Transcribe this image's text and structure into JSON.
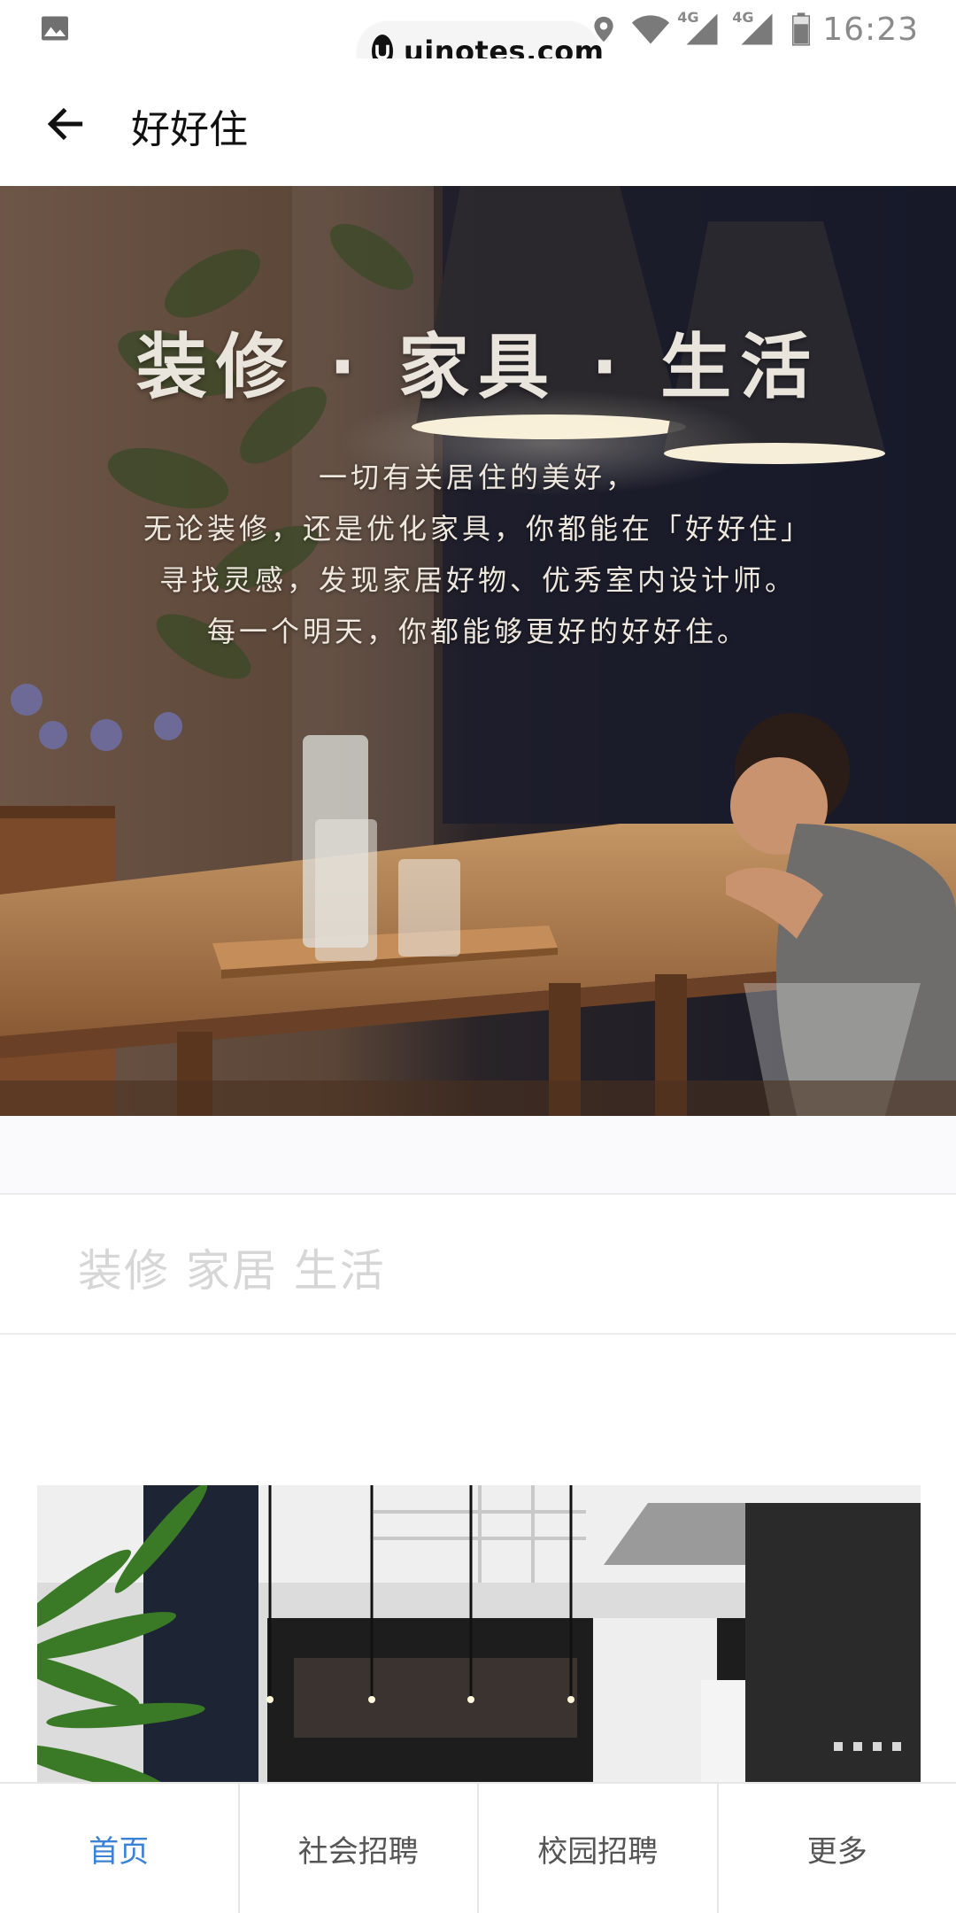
{
  "status_bar": {
    "time": "16:23",
    "network_label_1": "4G",
    "network_label_2": "4G",
    "icons": [
      "image-icon",
      "location-icon",
      "wifi-icon",
      "signal-icon",
      "battery-icon"
    ]
  },
  "watermark": {
    "text": "uinotes.com"
  },
  "app_bar": {
    "title": "好好住",
    "back_icon": "arrow-left-icon"
  },
  "hero": {
    "headline": "装修 · 家具 · 生活",
    "lines": [
      "一切有关居住的美好，",
      "无论装修，还是优化家具，你都能在「好好住」",
      "寻找灵感，发现家居好物、优秀室内设计师。",
      "每一个明天，你都能够更好的好好住。"
    ]
  },
  "slogan": {
    "text": "装修 家居 生活"
  },
  "bottom_nav": {
    "items": [
      {
        "label": "首页",
        "active": true
      },
      {
        "label": "社会招聘",
        "active": false
      },
      {
        "label": "校园招聘",
        "active": false
      },
      {
        "label": "更多",
        "active": false
      }
    ]
  },
  "colors": {
    "accent": "#3a82d6",
    "placeholder": "#d6d6d6",
    "divider": "#e6e6e6"
  }
}
